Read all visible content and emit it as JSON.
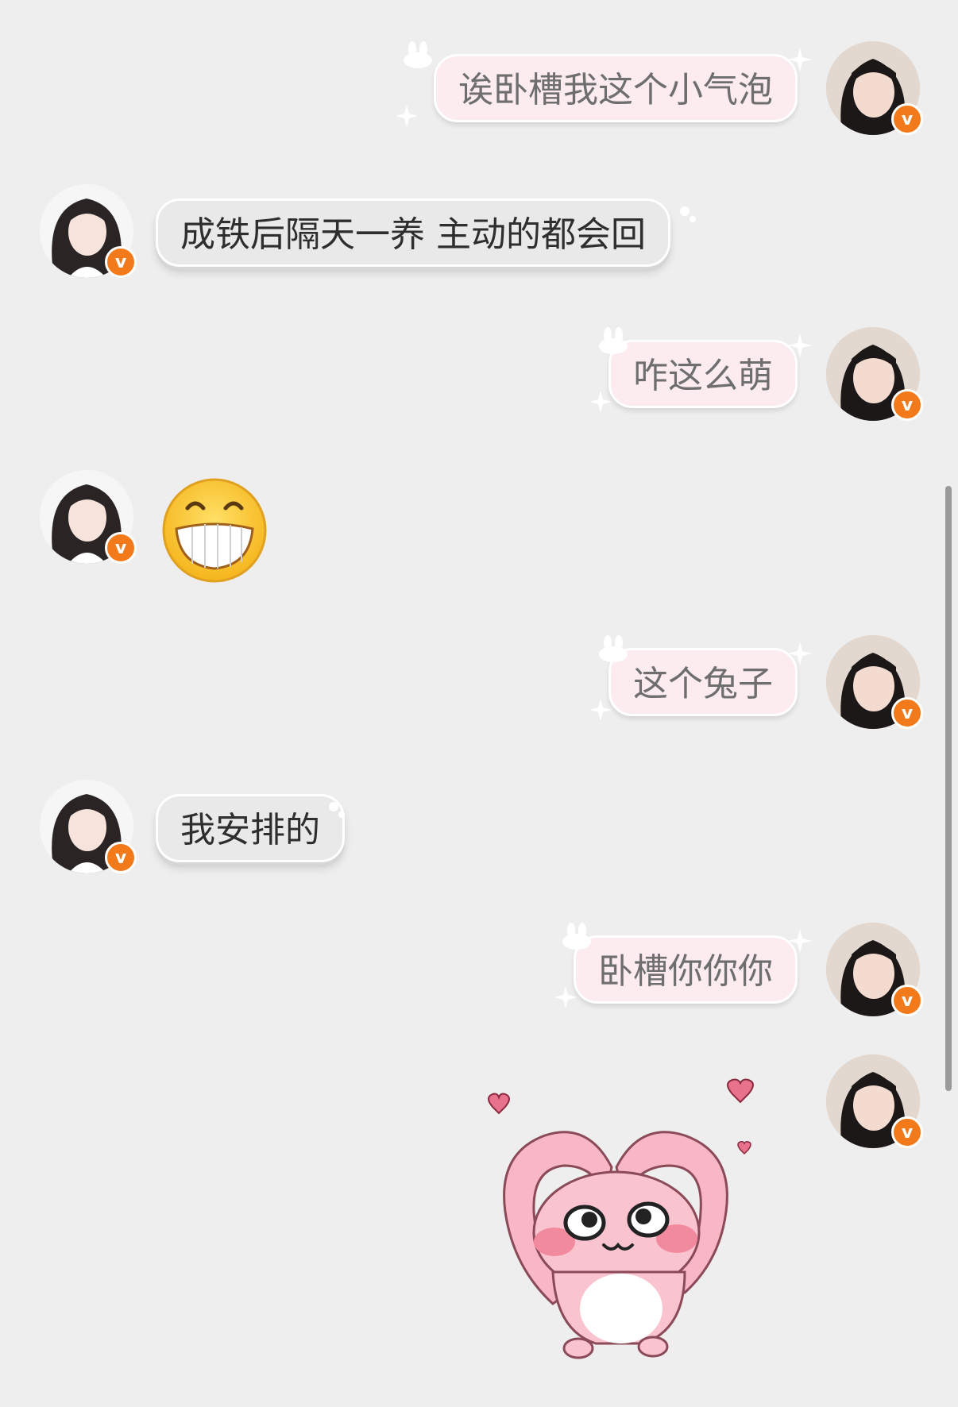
{
  "colors": {
    "background": "#eeeeee",
    "self_bubble": "#fcebef",
    "other_bubble": "#e9e9e9",
    "verified_badge": "#f27a1a"
  },
  "badge_label": "v",
  "messages": [
    {
      "side": "self",
      "type": "text",
      "text": "诶卧槽我这个小气泡"
    },
    {
      "side": "other",
      "type": "text",
      "text": "成铁后隔天一养 主动的都会回"
    },
    {
      "side": "self",
      "type": "text",
      "text": "咋这么萌"
    },
    {
      "side": "other",
      "type": "emoji",
      "icon": "grinning-face-emoji"
    },
    {
      "side": "self",
      "type": "text",
      "text": "这个兔子"
    },
    {
      "side": "other",
      "type": "text",
      "text": "我安排的"
    },
    {
      "side": "self",
      "type": "text",
      "text": "卧槽你你你"
    },
    {
      "side": "self",
      "type": "sticker",
      "icon": "pink-bunny-heart-sticker"
    }
  ]
}
